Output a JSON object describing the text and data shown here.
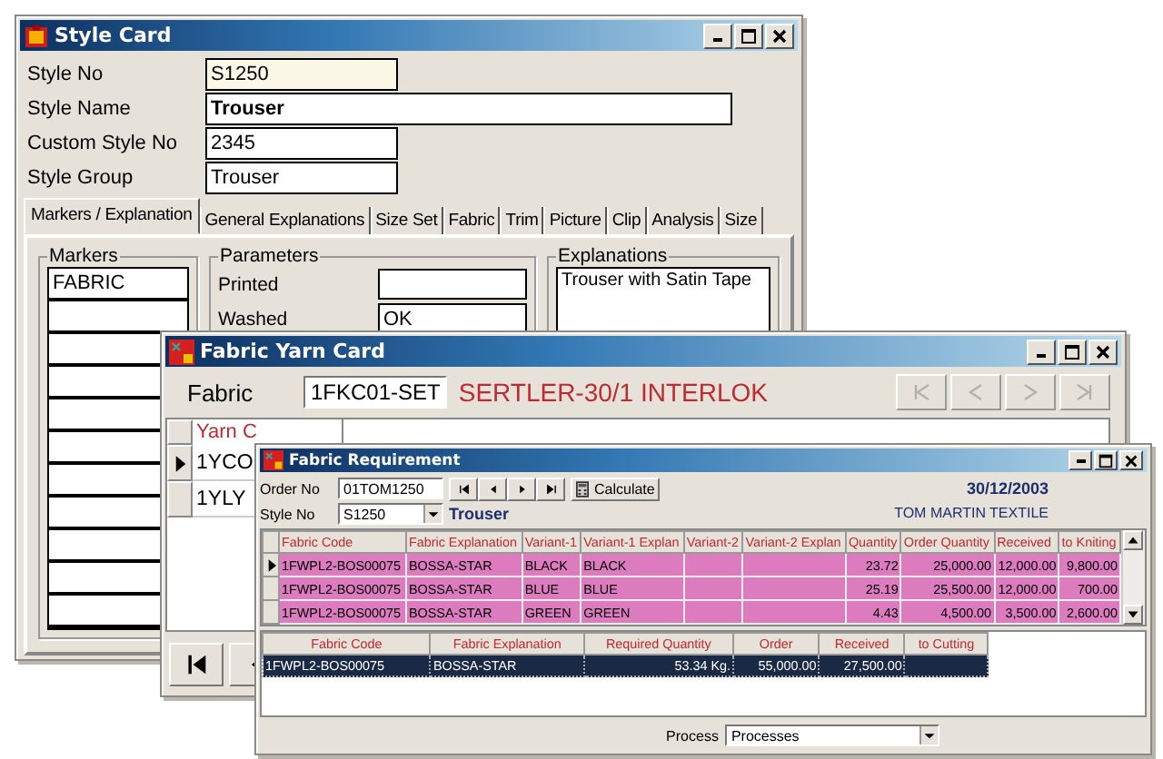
{
  "style_card": {
    "title": "Style Card",
    "fields": [
      {
        "label": "Style No",
        "value": "S1250",
        "kind": "key"
      },
      {
        "label": "Style Name",
        "value": "Trouser",
        "kind": "name"
      },
      {
        "label": "Custom Style No",
        "value": "2345",
        "kind": "plain"
      },
      {
        "label": "Style Group",
        "value": "Trouser",
        "kind": "plain"
      }
    ],
    "tabs": [
      {
        "label": "Markers / Explanation",
        "selected": true
      },
      {
        "label": "General Explanations",
        "selected": false
      },
      {
        "label": "Size Set",
        "selected": false
      },
      {
        "label": "Fabric",
        "selected": false
      },
      {
        "label": "Trim",
        "selected": false
      },
      {
        "label": "Picture",
        "selected": false
      },
      {
        "label": "Clip",
        "selected": false
      },
      {
        "label": "Analysis",
        "selected": false
      },
      {
        "label": "Size",
        "selected": false
      }
    ],
    "markers": {
      "title": "Markers",
      "items": [
        "FABRIC"
      ]
    },
    "parameters": {
      "title": "Parameters",
      "items": [
        {
          "label": "Printed"
        },
        {
          "label": "Washed",
          "value": "OK"
        }
      ]
    },
    "explanations": {
      "title": "Explanations",
      "text": "Trouser with Satin Tape"
    }
  },
  "fabric_yarn_card": {
    "title": "Fabric Yarn Card",
    "fabric_label": "Fabric",
    "fabric_code": "1FKC01-SET",
    "fabric_name": "SERTLER-30/1 INTERLOK",
    "record_nav": {
      "disabled": true
    },
    "column_1": "Yarn C",
    "rows": [
      {
        "code": "1YCO",
        "selected": true
      },
      {
        "code": "1YLY",
        "selected": false
      }
    ]
  },
  "fabric_requirement": {
    "title": "Fabric Requirement",
    "order_label": "Order No",
    "order_no": "01TOM1250",
    "calculate": "Calculate",
    "date": "30/12/2003",
    "style_label": "Style No",
    "style_no": "S1250",
    "style_name": "Trouser",
    "company": "TOM MARTIN TEXTILE",
    "columns": [
      "Fabric Code",
      "Fabric Explanation",
      "Variant-1",
      "Variant-1 Explan",
      "Variant-2",
      "Variant-2 Explan",
      "Quantity",
      "Order Quantity",
      "Received",
      "to Kniting"
    ],
    "rows": [
      {
        "selected": true,
        "cells": [
          "1FWPL2-BOS00075",
          "BOSSA-STAR",
          "BLACK",
          "BLACK",
          "",
          "",
          "23.72",
          "25,000.00",
          "12,000.00",
          "9,800.00"
        ]
      },
      {
        "selected": false,
        "cells": [
          "1FWPL2-BOS00075",
          "BOSSA-STAR",
          "BLUE",
          "BLUE",
          "",
          "",
          "25.19",
          "25,500.00",
          "12,000.00",
          "700.00"
        ]
      },
      {
        "selected": false,
        "cells": [
          "1FWPL2-BOS00075",
          "BOSSA-STAR",
          "GREEN",
          "GREEN",
          "",
          "",
          "4.43",
          "4,500.00",
          "3,500.00",
          "2,600.00"
        ]
      }
    ],
    "summary_columns": [
      "Fabric Code",
      "Fabric Explanation",
      "Required Quantity",
      "Order",
      "Received",
      "to Cutting"
    ],
    "summary_rows": [
      {
        "selected": true,
        "cells": [
          "1FWPL2-BOS00075",
          "BOSSA-STAR",
          "53.34 Kg.",
          "55,000.00",
          "27,500.00",
          ""
        ]
      }
    ],
    "process_label": "Process",
    "process": "Processes"
  }
}
